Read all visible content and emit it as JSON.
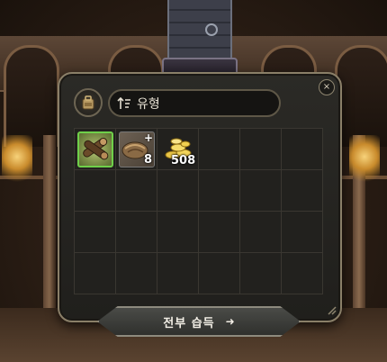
{
  "window": {
    "sort_label": "유형",
    "take_all_label": "전부 습득",
    "close_label": "×"
  },
  "icons": {
    "bag": "backpack-icon",
    "sort": "sort-order-icon",
    "close": "close-icon",
    "take_all_arrow": "arrow-right-icon"
  },
  "items": [
    {
      "name": "logs",
      "count": "",
      "highlighted": true
    },
    {
      "name": "bread-pack",
      "count": "8",
      "badge": "+"
    },
    {
      "name": "gold-coins",
      "count": "508"
    }
  ],
  "colors": {
    "highlight": "#6fd04a",
    "panel_border": "#8a7f68"
  }
}
